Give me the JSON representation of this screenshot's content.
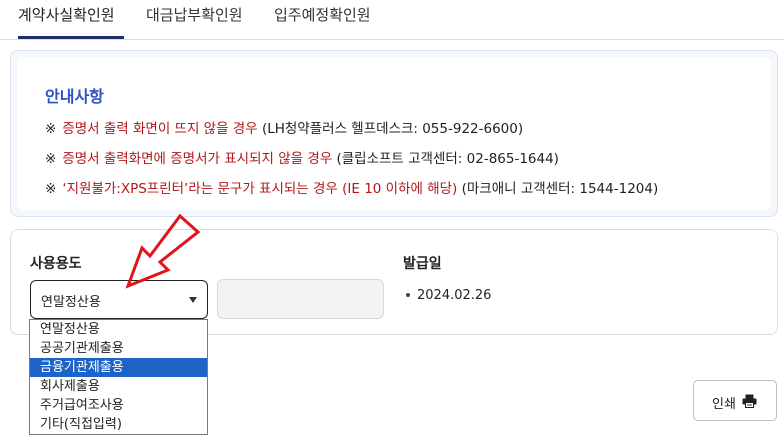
{
  "tabs": [
    {
      "label": "계약사실확인원",
      "active": true
    },
    {
      "label": "대금납부확인원",
      "active": false
    },
    {
      "label": "입주예정확인원",
      "active": false
    }
  ],
  "notice": {
    "title": "안내사항",
    "mark": "※",
    "lines": [
      {
        "red": "증명서 출력 화면이 뜨지 않을 경우",
        "black": " (LH청약플러스 헬프데스크: 055-922-6600)"
      },
      {
        "red": "증명서 출력화면에 증명서가 표시되지 않을 경우",
        "black": " (클립소프트 고객센터: 02-865-1644)"
      },
      {
        "red": "‘지원불가:XPS프린터’라는 문구가 표시되는 경우 (IE 10 이하에 해당)",
        "black": " (마크애니 고객센터: 1544-1204)"
      }
    ]
  },
  "form": {
    "usage_label": "사용용도",
    "usage_selected": "연말정산용",
    "issue_date_label": "발급일",
    "issue_date": "2024.02.26"
  },
  "dropdown": {
    "options": [
      "연말정산용",
      "공공기관제출용",
      "금융기관제출용",
      "회사제출용",
      "주거급여조사용",
      "기타(직접입력)"
    ],
    "highlighted_index": 2
  },
  "print_button": {
    "label": "인쇄",
    "icon": "printer-icon"
  },
  "colors": {
    "accent": "#2b54c2",
    "warning": "#b0181c",
    "highlight": "#1e64c8",
    "tab_underline": "#1f2f6e",
    "annotation_arrow": "#e0141c"
  }
}
